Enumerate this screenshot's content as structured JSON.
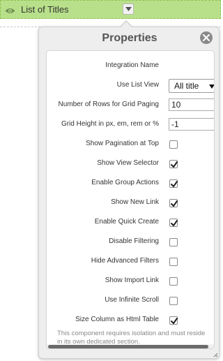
{
  "component": {
    "title": "List of Titles",
    "eye_icon": "eye-icon",
    "toggle_icon": "chevron-down-icon"
  },
  "panel": {
    "title": "Properties",
    "close_icon": "close-icon"
  },
  "properties": {
    "integration_name": {
      "label": "Integration Name",
      "value": ""
    },
    "use_list_view": {
      "label": "Use List View",
      "value": "All title"
    },
    "rows_grid_paging": {
      "label": "Number of Rows for Grid Paging",
      "value": "10"
    },
    "grid_height": {
      "label": "Grid Height in px, em, rem or %",
      "value": "-1"
    },
    "show_pagination_top": {
      "label": "Show Pagination at Top",
      "checked": false
    },
    "show_view_selector": {
      "label": "Show View Selector",
      "checked": true
    },
    "enable_group_actions": {
      "label": "Enable Group Actions",
      "checked": true
    },
    "show_new_link": {
      "label": "Show New Link",
      "checked": true
    },
    "enable_quick_create": {
      "label": "Enable Quick Create",
      "checked": true
    },
    "disable_filtering": {
      "label": "Disable Filtering",
      "checked": false
    },
    "hide_advanced_filters": {
      "label": "Hide Advanced Filters",
      "checked": false
    },
    "show_import_link": {
      "label": "Show Import Link",
      "checked": false
    },
    "use_infinite_scroll": {
      "label": "Use Infinite Scroll",
      "checked": false
    },
    "size_column_html_table": {
      "label": "Size Column as Html Table",
      "checked": true
    }
  },
  "note": "This component requires isolation and must reside in its own dedicated section.",
  "colors": {
    "component_bar": "#b8e08a",
    "panel_bg": "#eeeeee"
  }
}
